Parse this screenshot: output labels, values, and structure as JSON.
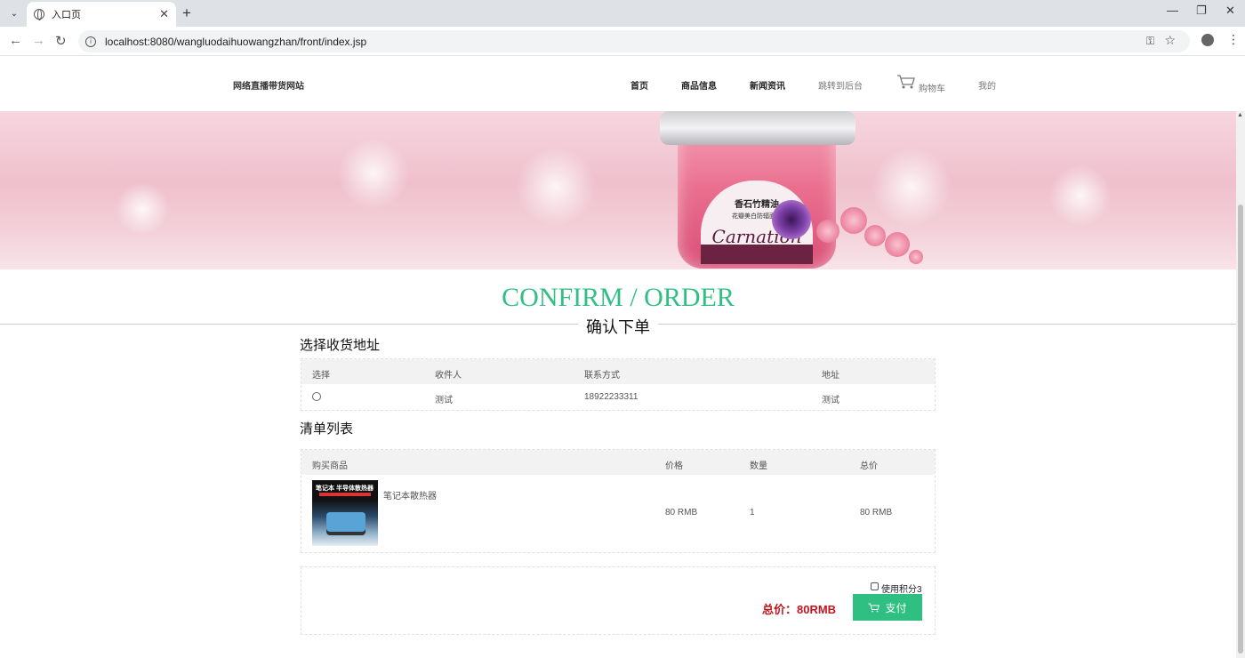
{
  "browser": {
    "tab_title": "入口页",
    "url": "localhost:8080/wangluodaihuowangzhan/front/index.jsp"
  },
  "site": {
    "title": "网络直播带货网站",
    "nav": {
      "home": "首页",
      "products": "商品信息",
      "news": "新闻资讯",
      "backend": "跳转到后台",
      "cart": "购物车",
      "mine": "我的"
    }
  },
  "banner": {
    "jar_line1": "香石竹精油",
    "jar_line2": "花瓣美白防辐面膜",
    "jar_brand": "Carnation"
  },
  "heading": {
    "title": "CONFIRM / ORDER",
    "subtitle": "确认下单"
  },
  "address_section": {
    "title": "选择收货地址",
    "headers": {
      "select": "选择",
      "recipient": "收件人",
      "contact": "联系方式",
      "address": "地址"
    },
    "rows": [
      {
        "recipient": "测试",
        "contact": "18922233311",
        "address": "测试"
      }
    ]
  },
  "order_section": {
    "title": "清单列表",
    "headers": {
      "product": "购买商品",
      "price": "价格",
      "quantity": "数量",
      "total": "总价"
    },
    "items": [
      {
        "name": "笔记本散热器",
        "image_caption": "笔记本 半导体散热器",
        "price": "80 RMB",
        "quantity": "1",
        "total": "80 RMB"
      }
    ]
  },
  "checkout": {
    "use_points_label": "使用积分3",
    "total_text": "总价：80RMB",
    "pay_label": "支付"
  },
  "colors": {
    "accent": "#2fbf82",
    "total_red": "#c0161f"
  }
}
